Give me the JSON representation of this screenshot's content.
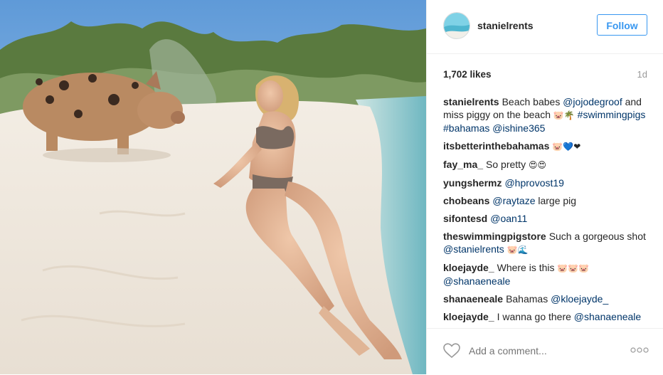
{
  "post": {
    "username": "stanielrents",
    "follow_label": "Follow",
    "likes": "1,702 likes",
    "age": "1d",
    "add_comment_placeholder": "Add a comment..."
  },
  "comments": [
    {
      "author": "stanielrents",
      "parts": [
        "Beach babes ",
        "@jojodegroof",
        " and miss piggy on the beach ",
        "🐷🌴",
        " ",
        "#swimmingpigs",
        " ",
        "#bahamas",
        " ",
        "@ishine365"
      ]
    },
    {
      "author": "itsbetterinthebahamas",
      "parts": [
        "🐷💙❤"
      ]
    },
    {
      "author": "fay_ma_",
      "parts": [
        "So pretty ",
        "😍😍"
      ]
    },
    {
      "author": "yungshermz",
      "parts": [
        "@hprovost19"
      ]
    },
    {
      "author": "chobeans",
      "parts": [
        "@raytaze",
        " large pig"
      ]
    },
    {
      "author": "sifontesd",
      "parts": [
        "@oan11"
      ]
    },
    {
      "author": "theswimmingpigstore",
      "parts": [
        "Such a gorgeous shot ",
        "@stanielrents",
        " ",
        "🐷🌊"
      ]
    },
    {
      "author": "kloejayde_",
      "parts": [
        "Where is this ",
        "🐷🐷🐷",
        " ",
        "@shanaeneale"
      ]
    },
    {
      "author": "shanaeneale",
      "parts": [
        "Bahamas ",
        "@kloejayde_"
      ]
    },
    {
      "author": "kloejayde_",
      "parts": [
        "I wanna go there ",
        "@shanaeneale"
      ]
    }
  ],
  "icons": {
    "like": "heart-icon",
    "more": "more-options-icon"
  },
  "colors": {
    "accent": "#3897f0",
    "link": "#003569",
    "muted": "#999999"
  }
}
